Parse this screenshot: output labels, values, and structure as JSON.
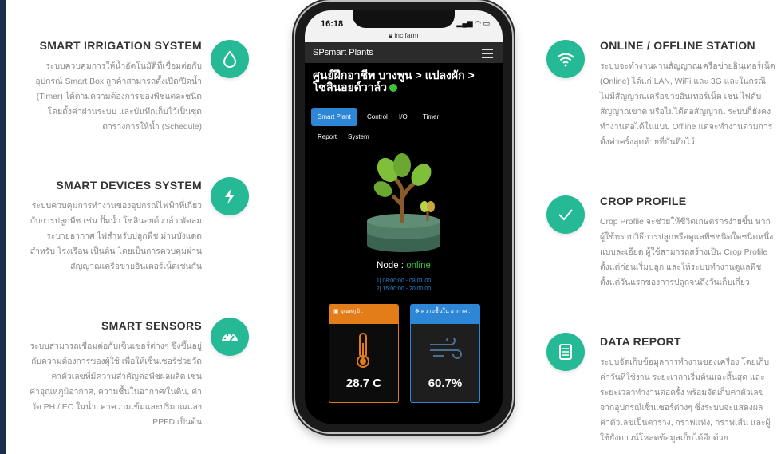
{
  "features_left": [
    {
      "title": "SMART IRRIGATION SYSTEM",
      "lines": [
        "ระบบควบคุมการให้น้ำอัตโนมัติที่เชื่อมต่อกับ",
        "อุปกรณ์ Smart Box ลูกค้าสามารถตั้งเปิด/ปิดน้ำ",
        "(Timer) ได้ตามความต้องการของพืชแต่ละชนิด",
        "โดยตั้งค่าผ่านระบบ และบันทึกเก็บไว้เป็นชุด",
        "ตารางการให้น้ำ (Schedule)"
      ],
      "icon": "water-drop-icon"
    },
    {
      "title": "SMART DEVICES SYSTEM",
      "lines": [
        "ระบบควบคุมการทำงานของอุปกรณ์ไฟฟ้าที่เกี่ยว",
        "กับการปลูกพืช เช่น ปั๊มน้ำ โซลินอยด์วาล์ว พัดลม",
        "ระบายอากาศ ไฟสำหรับปลูกพืช ม่านบังแดด",
        "สำหรับ โรงเรือน เป็นต้น โดยเป็นการควบคุมผ่าน",
        "สัญญาณเครือข่ายอินเตอร์เน็ตเช่นกัน"
      ],
      "icon": "lightning-icon"
    },
    {
      "title": "SMART SENSORS",
      "lines": [
        "ระบบสามารถเชื่อมต่อกับเซ็นเซอร์ต่างๆ ซึ่งขึ้นอยู่",
        "กับความต้องการของผู้ใช้ เพื่อให้เซ็นเซอร์ช่วยวัด",
        "ค่าตัวเลขที่มีความสำคัญต่อพืชผลผลิต เช่น",
        "ค่าอุณหภูมิอากาศ, ความชื้นในอากาศ/ในดิน, ค่า",
        "วัด PH / EC ในน้ำ, ค่าความเข้มและปริมาณแสง",
        "PPFD เป็นต้น"
      ],
      "icon": "gauge-icon"
    }
  ],
  "features_right": [
    {
      "title": "ONLINE / OFFLINE STATION",
      "lines": [
        "ระบบจะทำงานผ่านสัญญาณเครือข่ายอินเทอร์เน็ต",
        "(Online) ได้แก่ LAN, WiFi และ 3G และในกรณี",
        "ไม่มีสัญญาณเครือข่ายอินเทอร์เน็ต เช่น ไฟดับ",
        "สัญญาณขาด หรือไม่ได้ต่อสัญญาณ ระบบก็ยังคง",
        "ทำงานต่อได้ในแบบ Offline แต่จะทำงานตามการ",
        "ตั้งค่าครั้งสุดท้ายที่บันทึกไว้"
      ],
      "icon": "wifi-icon"
    },
    {
      "title": "CROP PROFILE",
      "lines": [
        "Crop Profile จะช่วยให้ชีวิตเกษตรกรง่ายขึ้น หาก",
        "ผู้ใช้ทราบวิธีการปลูกหรือดูแลพืชชนิดใดชนิดหนึ่ง",
        "แบบละเอียด ผู้ใช้สามารถสร้างเป็น Crop Profile",
        "ตั้งแต่ก่อนเริ่มปลูก และให้ระบบทำงานดูแลพืช",
        "ตั้งแต่วันแรกของการปลูกจนถึงวันเก็บเกี่ยว"
      ],
      "icon": "checkmark-icon"
    },
    {
      "title": "DATA REPORT",
      "lines": [
        "ระบบจัดเก็บข้อมูลการทำงานของเครื่อง โดยเก็บ",
        "ค่าวันที่ใช้งาน ระยะเวลาเริ่มต้นและสิ้นสุด และ",
        "ระยะเวลาทำงานต่อครั้ง พร้อมจัดเก็บค่าตัวเลข",
        "จากอุปกรณ์เซ็นเซอร์ต่างๆ ซึ่งระบบจะแสดงผล",
        "ค่าตัวเลขเป็นตาราง, กราฟแท่ง, กราฟเส้น และผู้",
        "ใช้ยังดาวน์โหลดข้อมูลเก็บได้อีกด้วย"
      ],
      "icon": "document-icon"
    }
  ],
  "phone": {
    "time": "16:18",
    "url": "inc.farm",
    "brand": "SPsmart Plants",
    "breadcrumb_line1": "ศูนย์ฝึกอาชีพ บางพูน > แปลงผัก >",
    "breadcrumb_line2": "โซลินอยด์วาล์ว",
    "tabs": [
      "Smart Plant",
      "Control",
      "I/O",
      "Timer",
      "Report",
      "System"
    ],
    "node_label": "Node :",
    "node_status": "online",
    "schedule": [
      "1| 08:00:00 - 08:01:00",
      "2| 15:00:00 - 20:00:00"
    ],
    "temp_label": "อุณหภูมิ :",
    "temp_value": "28.7 C",
    "humidity_label": "ความชื้นใน อากาศ :",
    "humidity_value": "60.7%"
  },
  "colors": {
    "accent": "#25b995",
    "tab_active": "#2d86d6",
    "online": "#39c43a",
    "temp": "#e27d1a"
  }
}
